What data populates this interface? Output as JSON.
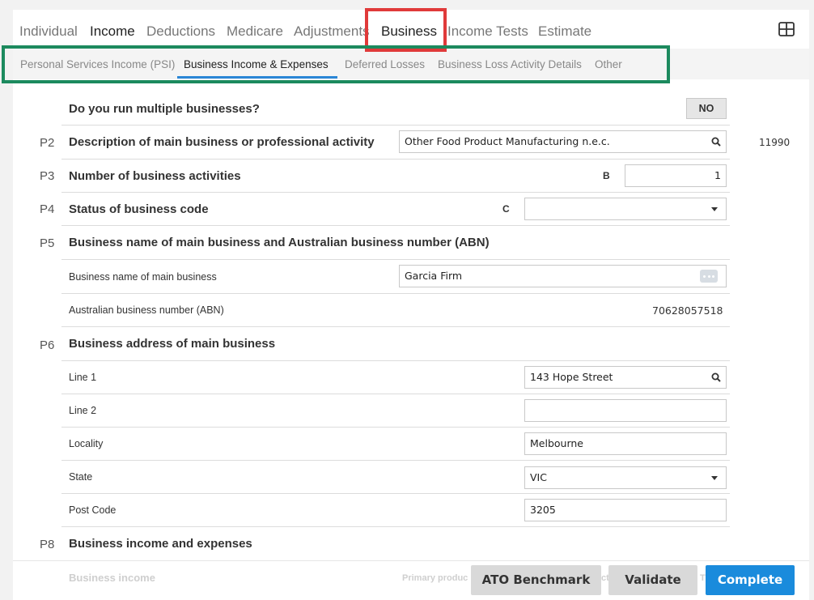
{
  "tabs": [
    {
      "label": "Individual"
    },
    {
      "label": "Income"
    },
    {
      "label": "Deductions"
    },
    {
      "label": "Medicare"
    },
    {
      "label": "Adjustments"
    },
    {
      "label": "Business"
    },
    {
      "label": "Income Tests"
    },
    {
      "label": "Estimate"
    }
  ],
  "subtabs": [
    {
      "label": "Personal Services Income (PSI)"
    },
    {
      "label": "Business Income & Expenses"
    },
    {
      "label": "Deferred Losses"
    },
    {
      "label": "Business Loss Activity Details"
    },
    {
      "label": "Other"
    }
  ],
  "form": {
    "multiple_businesses": {
      "label": "Do you run multiple businesses?",
      "value": "NO"
    },
    "p2": {
      "num": "P2",
      "label": "Description of main business or professional activity",
      "value": "Other Food Product Manufacturing n.e.c.",
      "code": "11990"
    },
    "p3": {
      "num": "P3",
      "label": "Number of business activities",
      "tag": "B",
      "value": "1"
    },
    "p4": {
      "num": "P4",
      "label": "Status of business code",
      "tag": "C",
      "value": ""
    },
    "p5": {
      "num": "P5",
      "label": "Business name of main business and Australian business number (ABN)",
      "name_label": "Business name of main business",
      "name_value": "Garcia Firm",
      "abn_label": "Australian business number (ABN)",
      "abn_value": "70628057518"
    },
    "p6": {
      "num": "P6",
      "label": "Business address of main business",
      "line1_label": "Line 1",
      "line1_value": "143  Hope Street",
      "line2_label": "Line 2",
      "line2_value": "",
      "locality_label": "Locality",
      "locality_value": "Melbourne",
      "state_label": "State",
      "state_value": "VIC",
      "postcode_label": "Post Code",
      "postcode_value": "3205"
    },
    "p8": {
      "num": "P8",
      "label": "Business income and expenses",
      "income_label": "Business income",
      "col_label": "Primary produc",
      "col_label2": "ct",
      "col_label3": "T"
    }
  },
  "buttons": {
    "benchmark": "ATO Benchmark",
    "validate": "Validate",
    "complete": "Complete"
  },
  "colors": {
    "accent_green": "#2d7a5f",
    "subtab_blue": "#2a86d6",
    "complete_blue": "#1a8bdc",
    "highlight_red": "#e03a3a",
    "highlight_green": "#1c8a5e"
  }
}
